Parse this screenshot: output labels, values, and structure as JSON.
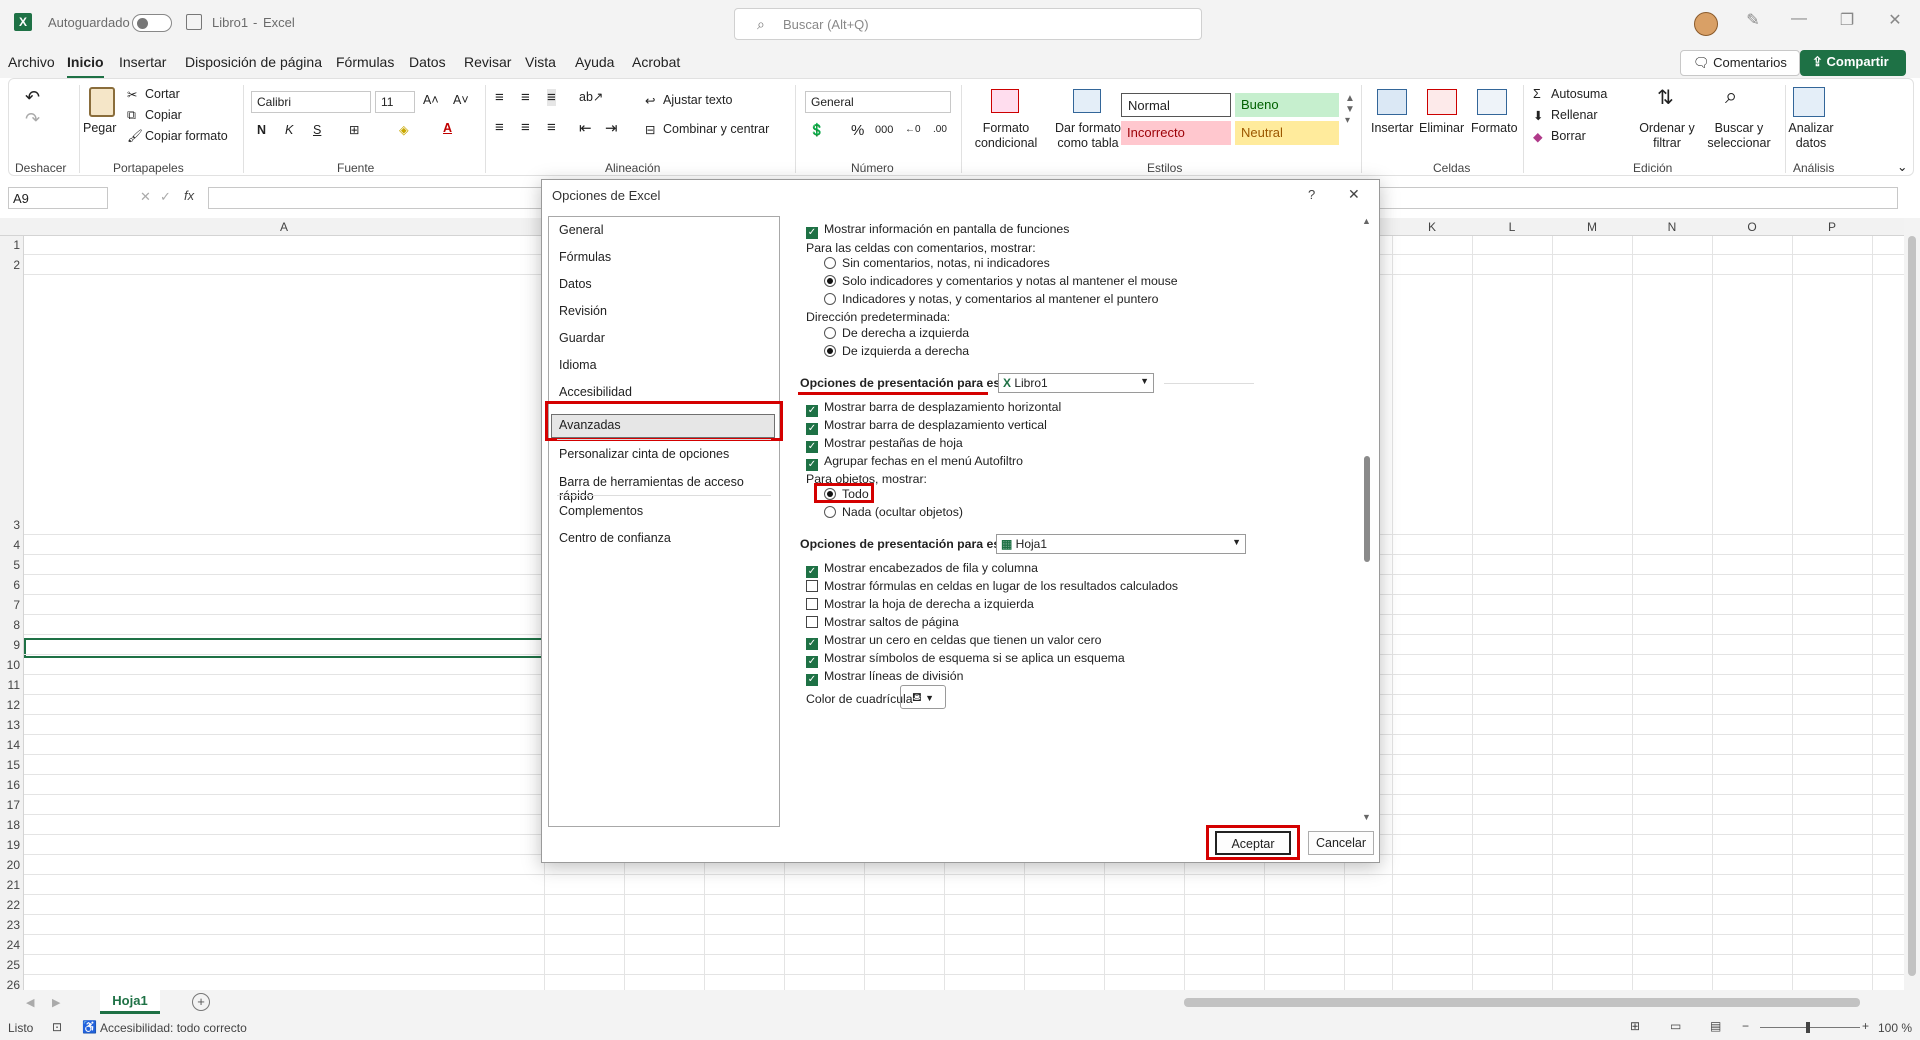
{
  "titlebar": {
    "autosave": "Autoguardado",
    "doc": "Libro1",
    "sep": "-",
    "app": "Excel",
    "search_placeholder": "Buscar (Alt+Q)"
  },
  "menu": {
    "tabs": [
      "Archivo",
      "Inicio",
      "Insertar",
      "Disposición de página",
      "Fórmulas",
      "Datos",
      "Revisar",
      "Vista",
      "Ayuda",
      "Acrobat"
    ],
    "comments": "Comentarios",
    "share": "Compartir"
  },
  "ribbon": {
    "undo_group": "Deshacer",
    "paste": "Pegar",
    "cut": "Cortar",
    "copy": "Copiar",
    "format_painter": "Copiar formato",
    "clipboard_group": "Portapapeles",
    "font": "Calibri",
    "font_size": "11",
    "bold": "N",
    "italic": "K",
    "underline": "S",
    "font_group": "Fuente",
    "wrap": "Ajustar texto",
    "merge": "Combinar y centrar",
    "align_group": "Alineación",
    "number_format": "General",
    "number_group": "Número",
    "cond_format_1": "Formato",
    "cond_format_2": "condicional",
    "table_format_1": "Dar formato",
    "table_format_2": "como tabla",
    "styles": [
      "Normal",
      "Bueno",
      "Incorrecto",
      "Neutral"
    ],
    "styles_group": "Estilos",
    "insert": "Insertar",
    "delete": "Eliminar",
    "format": "Formato",
    "cells_group": "Celdas",
    "autosum": "Autosuma",
    "fill": "Rellenar",
    "clear": "Borrar",
    "sort_1": "Ordenar y",
    "sort_2": "filtrar",
    "find_1": "Buscar y",
    "find_2": "seleccionar",
    "edit_group": "Edición",
    "analyze_1": "Analizar",
    "analyze_2": "datos",
    "analysis_group": "Análisis"
  },
  "formula": {
    "namebox": "A9",
    "fx": "fx"
  },
  "grid": {
    "columns": [
      "A",
      "K",
      "L",
      "M",
      "N",
      "O",
      "P"
    ],
    "rows": [
      "1",
      "2",
      "3",
      "4",
      "5",
      "6",
      "7",
      "8",
      "9",
      "10",
      "11",
      "12",
      "13",
      "14",
      "15",
      "16",
      "17",
      "18",
      "19",
      "20",
      "21",
      "22",
      "23",
      "24",
      "25",
      "26"
    ]
  },
  "sheet": {
    "tab": "Hoja1",
    "add": "+"
  },
  "status": {
    "ready": "Listo",
    "accessibility": "Accesibilidad: todo correcto",
    "zoom": "100 %"
  },
  "dialog": {
    "title": "Opciones de Excel",
    "help": "?",
    "close": "✕",
    "nav": [
      "General",
      "Fórmulas",
      "Datos",
      "Revisión",
      "Guardar",
      "Idioma",
      "Accesibilidad",
      "Avanzadas",
      "Personalizar cinta de opciones",
      "Barra de herramientas de acceso rápido",
      "Complementos",
      "Centro de confianza"
    ],
    "opt_function_screentips": "Mostrar información en pantalla de funciones",
    "comments_label": "Para las celdas con comentarios, mostrar:",
    "comments_none": "Sin comentarios, notas, ni indicadores",
    "comments_indicators": "Solo indicadores y comentarios y notas al mantener el mouse",
    "comments_all": "Indicadores y notas, y comentarios al mantener el puntero",
    "direction_label": "Dirección predeterminada:",
    "dir_rtl": "De derecha a izquierda",
    "dir_ltr": "De izquierda a derecha",
    "book_section": "Opciones de presentación para este libro:",
    "book_value": "Libro1",
    "opt_hscroll": "Mostrar barra de desplazamiento horizontal",
    "opt_vscroll": "Mostrar barra de desplazamiento vertical",
    "opt_tabs": "Mostrar pestañas de hoja",
    "opt_group_dates": "Agrupar fechas en el menú Autofiltro",
    "objects_label": "Para objetos, mostrar:",
    "obj_all": "Todo",
    "obj_none": "Nada (ocultar objetos)",
    "sheet_section": "Opciones de presentación para esta hoja:",
    "sheet_value": "Hoja1",
    "opt_headers": "Mostrar encabezados de fila y columna",
    "opt_formulas": "Mostrar fórmulas en celdas en lugar de los resultados calculados",
    "opt_rtl_sheet": "Mostrar la hoja de derecha a izquierda",
    "opt_page_breaks": "Mostrar saltos de página",
    "opt_zero": "Mostrar un cero en celdas que tienen un valor cero",
    "opt_outline": "Mostrar símbolos de esquema si se aplica un esquema",
    "opt_gridlines": "Mostrar líneas de división",
    "grid_color_label": "Color de cuadrícula",
    "ok": "Aceptar",
    "cancel": "Cancelar"
  },
  "colors": {
    "accent": "#1e7145",
    "highlight": "#d40000"
  }
}
